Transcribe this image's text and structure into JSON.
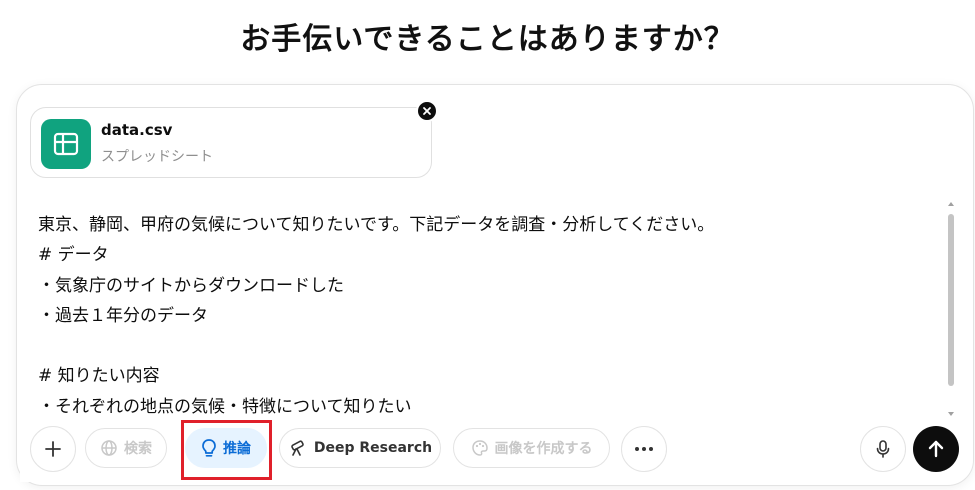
{
  "headline": "お手伝いできることはありますか？",
  "attachment": {
    "name": "data.csv",
    "type": "スプレッドシート",
    "icon": "spreadsheet-icon",
    "icon_color": "#10a37f"
  },
  "prompt_lines": [
    "東京、静岡、甲府の気候について知りたいです。下記データを調査・分析してください。",
    "# データ",
    "・気象庁のサイトからダウンロードした",
    "・過去１年分のデータ",
    "",
    "# 知りたい内容",
    "・それぞれの地点の気候・特徴について知りたい"
  ],
  "toolbar": {
    "plus_icon": "plus-icon",
    "search_label": "検索",
    "reason_label": "推論",
    "deep_research_label": "Deep Research",
    "create_image_label": "画像を作成する",
    "more_icon": "more-icon",
    "mic_icon": "microphone-icon",
    "send_icon": "arrow-up-icon"
  },
  "colors": {
    "active_bg": "#e6f3ff",
    "active_text": "#0b6cd6",
    "highlight": "#e0202a",
    "send_bg": "#0d0d0d"
  }
}
